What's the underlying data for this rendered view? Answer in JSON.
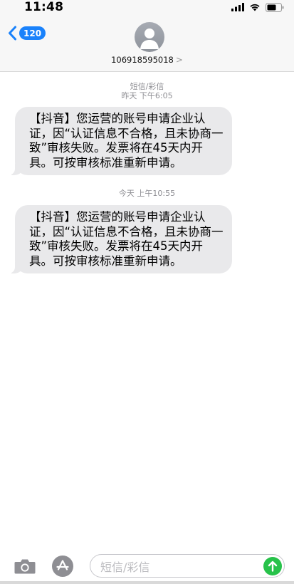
{
  "status_bar": {
    "time": "11:48"
  },
  "header": {
    "unread_count": "120",
    "contact_number": "106918595018",
    "contact_chevron": ">"
  },
  "thread": {
    "service_label": "短信/彩信",
    "messages": [
      {
        "timestamp": "昨天 下午6:05",
        "text": "【抖音】您运营的账号申请企业认证，因“认证信息不合格，且未协商一致”审核失败。发票将在45天内开具。可按审核标准重新申请。"
      },
      {
        "timestamp": "今天 上午10:55",
        "text": "【抖音】您运营的账号申请企业认证，因“认证信息不合格，且未协商一致”审核失败。发票将在45天内开具。可按审核标准重新申请。"
      }
    ]
  },
  "composer": {
    "placeholder": "短信/彩信"
  },
  "icons": {
    "back": "chevron-left-icon",
    "avatar": "person-icon",
    "camera": "camera-icon",
    "app_store": "app-store-icon",
    "send": "arrow-up-icon",
    "signal": "signal-icon",
    "wifi": "wifi-icon",
    "battery": "battery-icon"
  },
  "colors": {
    "accent": "#1a82fb",
    "bubble": "#e9e9eb",
    "send": "#27c24a"
  }
}
